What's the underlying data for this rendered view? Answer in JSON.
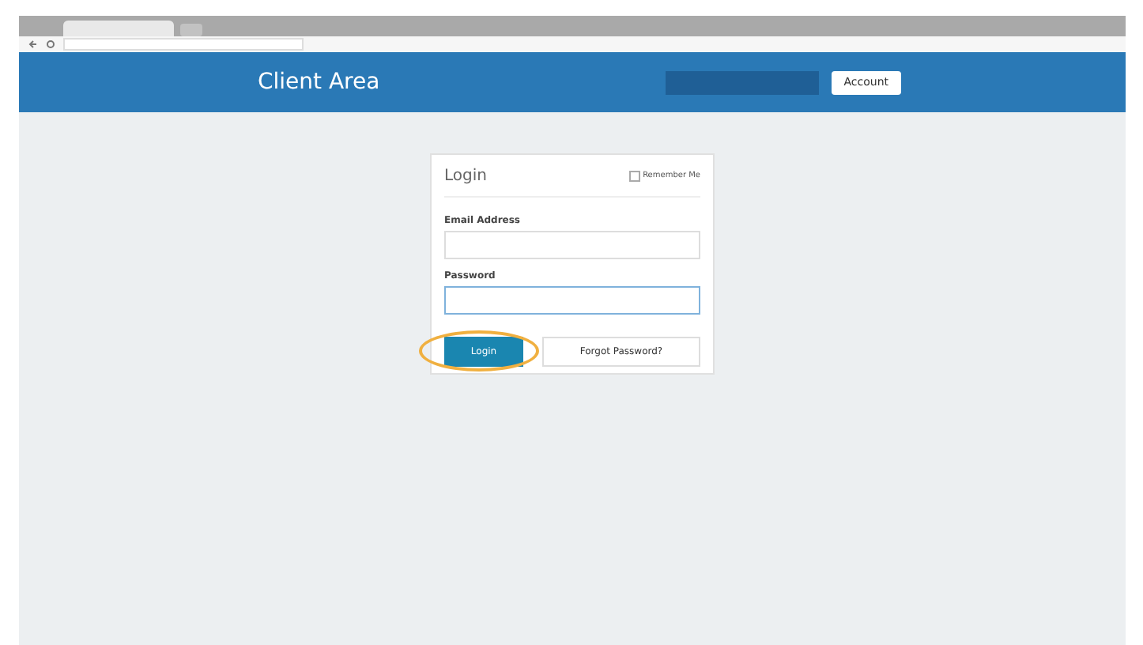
{
  "header": {
    "title": "Client Area",
    "account_button": "Account"
  },
  "login": {
    "title": "Login",
    "remember": {
      "label": "Remember Me",
      "checked": false
    },
    "email_label": "Email Address",
    "password_label": "Password",
    "password_focused": true,
    "login_button": "Login",
    "forgot_button": "Forgot Password?",
    "highlighted": true
  }
}
